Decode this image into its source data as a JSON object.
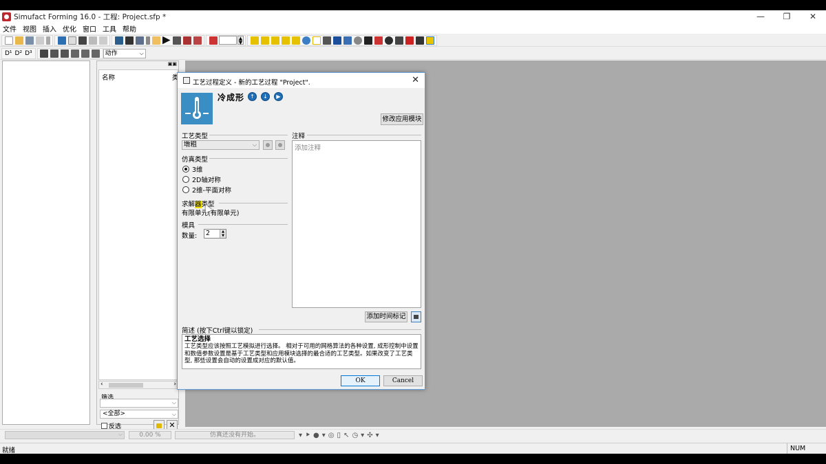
{
  "window": {
    "title": "Simufact Forming 16.0 - 工程: Project.sfp *",
    "controls": [
      "—",
      "❐",
      "✕"
    ]
  },
  "menu": [
    "文件",
    "视图",
    "插入",
    "优化",
    "窗口",
    "工具",
    "帮助"
  ],
  "toolbar2": {
    "labels": [
      "D¹",
      "D²",
      "D³"
    ],
    "action_select": "动作"
  },
  "tree_panel": {
    "col_name": "名称",
    "col_type": "类",
    "filter_label": "筛选",
    "filter_select": "<全部>",
    "invert_label": "反选",
    "delete_icon": "✕"
  },
  "dialog": {
    "title": "工艺过程定义 - 新的工艺过程 \"Project\".",
    "close": "✕",
    "process_name": "冷成形",
    "modify_button": "修改应用模块",
    "process_type_label": "工艺类型",
    "process_type_value": "墩粗",
    "sim_type_label": "仿真类型",
    "sim_types": [
      "3维",
      "2D轴对称",
      "2维-平面对称"
    ],
    "sim_type_selected": 0,
    "solver_label_a": "求解",
    "solver_label_hl": "器",
    "solver_label_b": "类型",
    "solver_value": "有限单元(有限单元)",
    "dies_label": "模具",
    "count_label": "数量:",
    "count_value": "2",
    "notes_label": "注释",
    "notes_placeholder": "添加注释",
    "timestamp_button": "添加时间标记",
    "desc_label": "简述 (按下Ctrl键以锁定)",
    "desc_heading": "工艺选择",
    "desc_body": "工艺类型应该按照工艺模拟进行选择。 相对于可用的网格算法的各种设置, 成形控制中设置和数值参数设置是基于工艺类型和应用模块选择的最合适的工艺类型。如果改变了工艺类型, 那些设置会自动的设置成对应的默认值。",
    "ok_button": "OK",
    "cancel_button": "Cancel"
  },
  "progress": {
    "percent": "0.00 %",
    "status": "仿真还没有开始。"
  },
  "statusbar": {
    "left": "就绪",
    "num": "NUM"
  },
  "colors": {
    "accent": "#3b8ec4",
    "workspace": "#aaaaaa"
  }
}
